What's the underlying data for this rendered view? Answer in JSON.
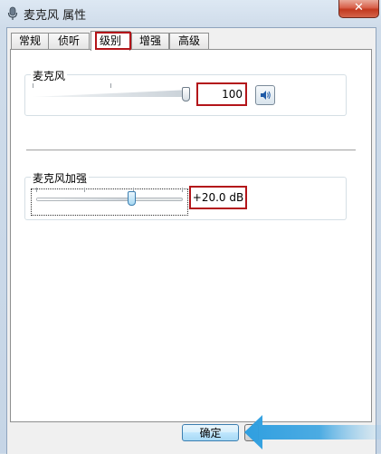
{
  "window": {
    "title": "麦克风 属性",
    "close_label": "✕"
  },
  "tabs": [
    {
      "label": "常规"
    },
    {
      "label": "侦听"
    },
    {
      "label": "级别"
    },
    {
      "label": "增强"
    },
    {
      "label": "高级"
    }
  ],
  "active_tab": "级别",
  "microphone": {
    "label": "麦克风",
    "level": 100,
    "level_text": "100",
    "speaker_icon": "speaker-volume-icon"
  },
  "boost": {
    "label": "麦克风加强",
    "value_text": "+20.0 dB",
    "level_fraction": 0.66
  },
  "buttons": {
    "ok_label": "确定"
  },
  "colors": {
    "highlight": "#b3151a",
    "arrow": "#2f9fe0"
  }
}
